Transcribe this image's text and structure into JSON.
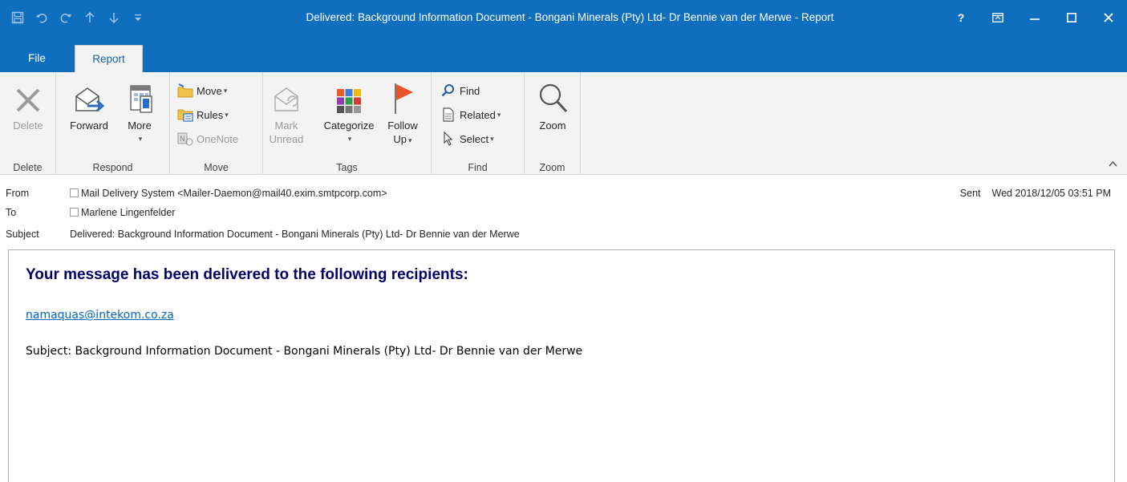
{
  "window": {
    "title": "Delivered: Background Information Document - Bongani Minerals (Pty) Ltd- Dr Bennie van der Merwe - Report",
    "help_label": "?",
    "accent": "#106ebe"
  },
  "tabs": [
    {
      "label": "File",
      "active": false
    },
    {
      "label": "Report",
      "active": true
    }
  ],
  "ribbon": {
    "groups": {
      "delete": "Delete",
      "respond": "Respond",
      "move": "Move",
      "tags": "Tags",
      "find": "Find",
      "zoom": "Zoom"
    },
    "buttons": {
      "delete": "Delete",
      "forward": "Forward",
      "more": "More",
      "move": "Move",
      "rules": "Rules",
      "onenote": "OneNote",
      "mark_unread_1": "Mark",
      "mark_unread_2": "Unread",
      "categorize": "Categorize",
      "follow_up_1": "Follow",
      "follow_up_2": "Up",
      "find": "Find",
      "related": "Related",
      "select": "Select",
      "zoom": "Zoom"
    }
  },
  "header": {
    "from_label": "From",
    "from_value": "Mail Delivery System <Mailer-Daemon@mail40.exim.smtpcorp.com>",
    "to_label": "To",
    "to_value": "Marlene Lingenfelder",
    "subject_label": "Subject",
    "subject_value": "Delivered: Background Information Document - Bongani Minerals (Pty) Ltd- Dr Bennie van der Merwe",
    "sent_label": "Sent",
    "sent_value": "Wed 2018/12/05 03:51 PM"
  },
  "message": {
    "heading": "Your message has been delivered to the following recipients:",
    "recipient": "namaquas@intekom.co.za",
    "subject_line": "Subject: Background Information Document - Bongani Minerals (Pty) Ltd- Dr Bennie van der Merwe"
  }
}
